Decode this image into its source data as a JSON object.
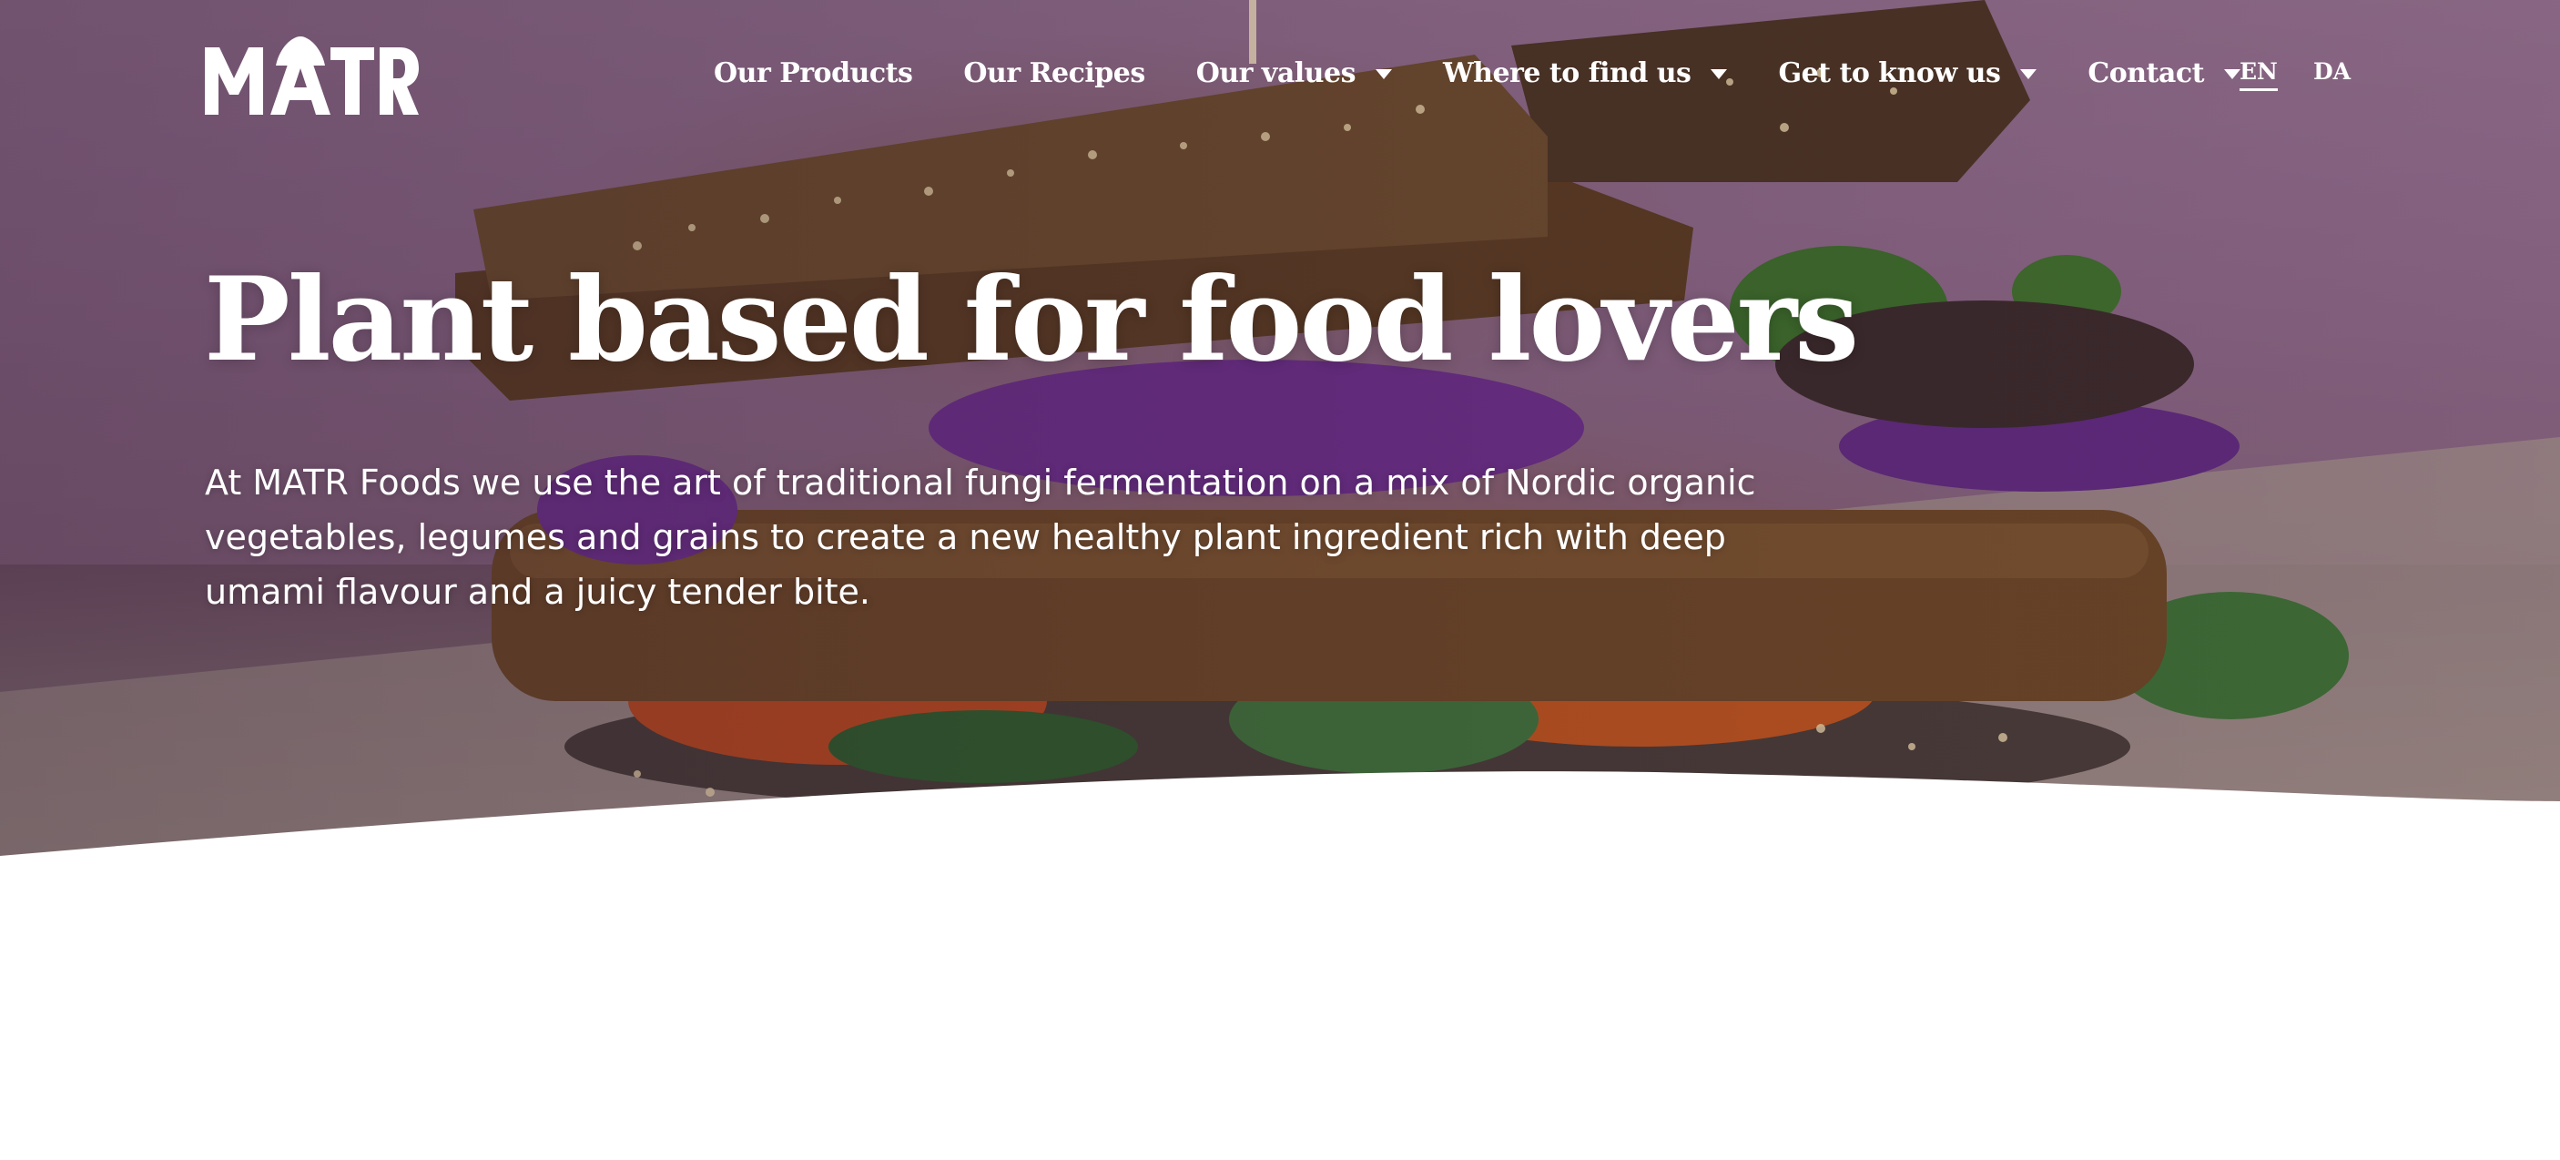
{
  "brand": {
    "logo_text": "MATR",
    "colors": {
      "text_on_hero": "#ffffff",
      "page_background": "#ffffff",
      "hero_tint": "#7d5b78"
    }
  },
  "nav": {
    "items": [
      {
        "label": "Our Products",
        "has_dropdown": false
      },
      {
        "label": "Our Recipes",
        "has_dropdown": false
      },
      {
        "label": "Our values",
        "has_dropdown": true
      },
      {
        "label": "Where to find us",
        "has_dropdown": true
      },
      {
        "label": "Get to know us",
        "has_dropdown": true
      },
      {
        "label": "Contact",
        "has_dropdown": true
      }
    ],
    "dropdown_icon": "caret-down-icon"
  },
  "language": {
    "options": [
      "EN",
      "DA"
    ],
    "selected": "EN"
  },
  "hero": {
    "title": "Plant based for food lovers",
    "subtitle": "At MATR Foods we use the art of traditional fungi fermentation on a mix of Nordic organic vegetables, legumes and grains to create a new healthy plant ingredient rich with deep umami flavour and a juicy tender bite.",
    "image": "plant-based-sandwich-photo"
  }
}
